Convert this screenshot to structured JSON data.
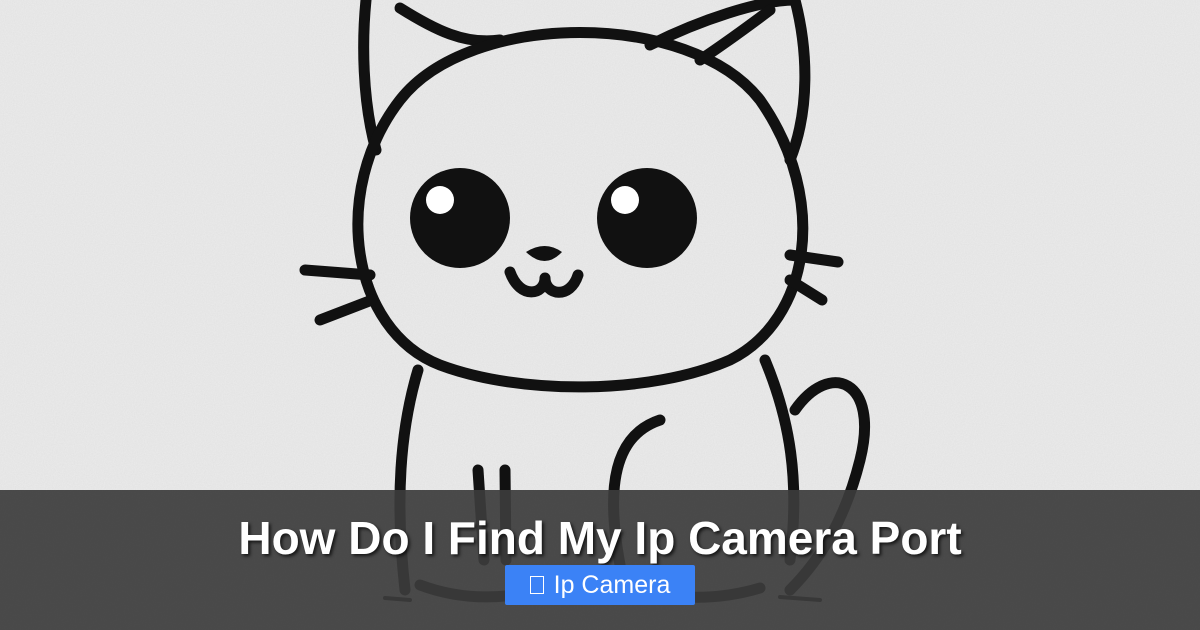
{
  "hero_image": {
    "subject": "cat-line-drawing",
    "stroke_color": "#111111",
    "paper_color": "#ececec"
  },
  "overlay": {
    "title": "How Do I Find My Ip Camera Port",
    "category_label": "Ip Camera",
    "category_icon": "folder-icon",
    "tag_color": "#3b82f6",
    "overlay_color": "#3c3c3c"
  }
}
